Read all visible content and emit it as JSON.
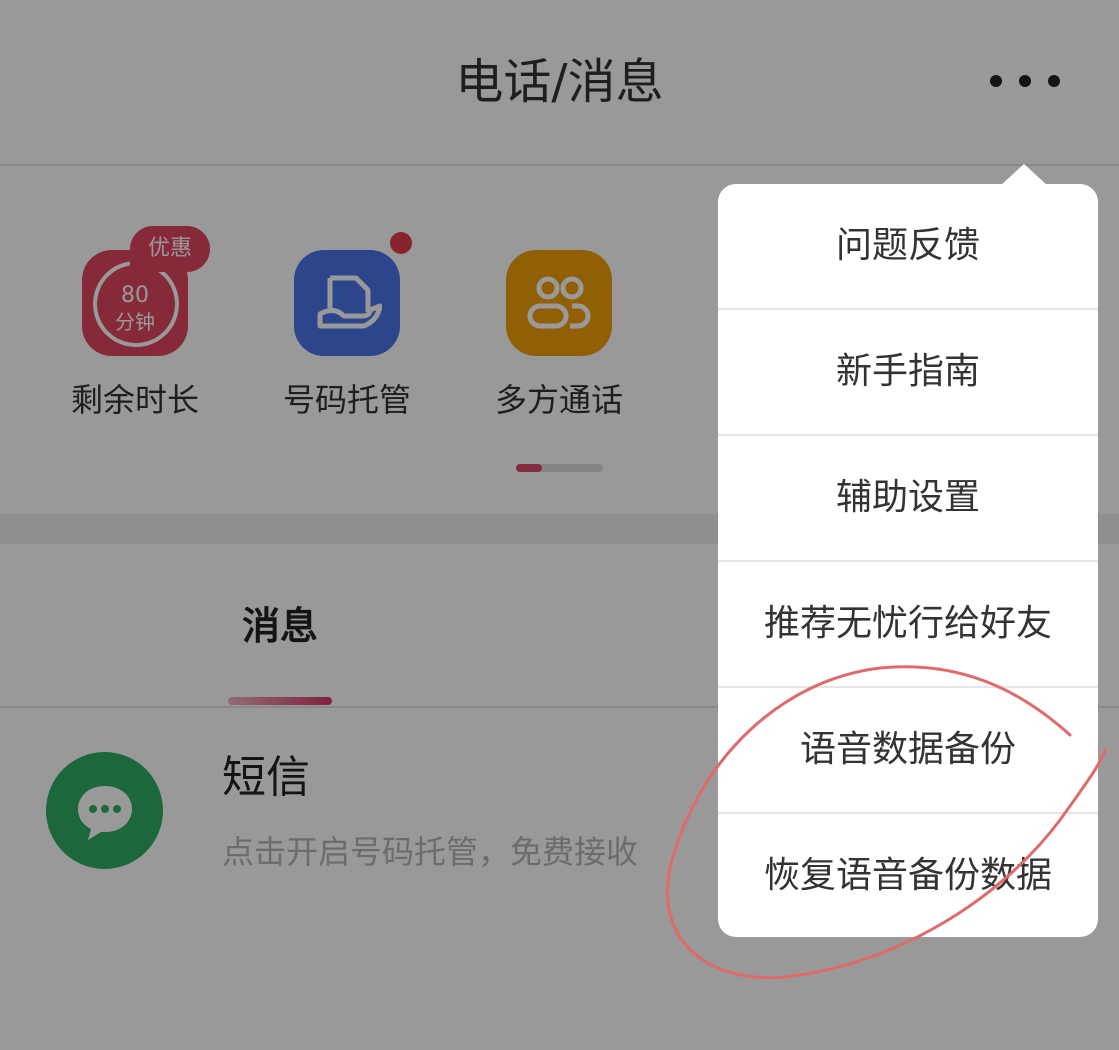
{
  "header": {
    "title": "电话/消息",
    "more_icon": "more-dots-icon"
  },
  "shortcuts": [
    {
      "label": "剩余时长",
      "icon": "remaining-time-icon",
      "value": "80",
      "unit": "分钟",
      "badge": "优惠",
      "color": "#e0455f"
    },
    {
      "label": "号码托管",
      "icon": "number-hosting-icon",
      "color": "#4c74e8",
      "has_dot": true
    },
    {
      "label": "多方通话",
      "icon": "conference-call-icon",
      "color": "#f2a10a"
    }
  ],
  "tabs": {
    "messages": "消息"
  },
  "message_item": {
    "title": "短信",
    "subtitle": "点击开启号码托管，免费接收",
    "icon": "chat-bubble-icon",
    "color": "#2fae64"
  },
  "menu": {
    "items": [
      {
        "label": "问题反馈"
      },
      {
        "label": "新手指南"
      },
      {
        "label": "辅助设置"
      },
      {
        "label": "推荐无忧行给好友"
      },
      {
        "label": "语音数据备份"
      },
      {
        "label": "恢复语音备份数据"
      }
    ]
  },
  "colors": {
    "accent": "#d94a6a",
    "overlay": "rgba(0,0,0,0.4)",
    "annotation": "#e06a6a"
  }
}
